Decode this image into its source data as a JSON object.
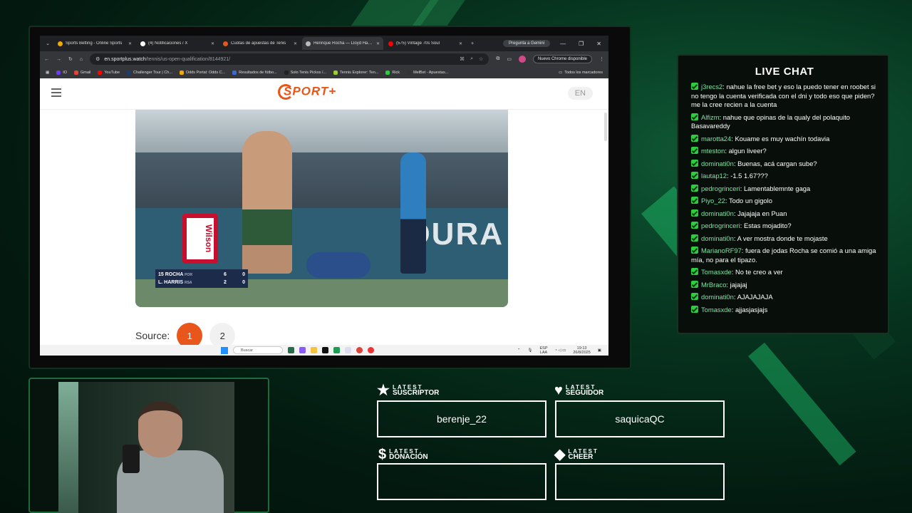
{
  "browser": {
    "tabs": [
      {
        "title": "Sports Betting - Online Sports",
        "color": "#f2a900",
        "active": false
      },
      {
        "title": "(4) Notificaciones / X",
        "color": "#ffffff",
        "active": false
      },
      {
        "title": "Cuotas de apuestas de Tenis",
        "color": "#e8561b",
        "active": false
      },
      {
        "title": "Henrique Rocha — Lloyd Harris",
        "color": "#bbbbbb",
        "active": true
      },
      {
        "title": "(575) Vintage 70s Soul",
        "color": "#ff0000",
        "active": false
      }
    ],
    "gemini_label": "Pregunta a Gemini",
    "url_host": "en.sportplus.watch",
    "url_path": "/tennis/us-open-qualification/8144921/",
    "chrome_update": "Nuevo Chrome disponible",
    "bookmarks": [
      {
        "label": "IO",
        "color": "#6a3df0"
      },
      {
        "label": "Gmail",
        "color": "#ea4335"
      },
      {
        "label": "YouTube",
        "color": "#ff0000"
      },
      {
        "label": "Challenger Tour | Ch...",
        "color": "#1f3b73"
      },
      {
        "label": "Odds Portal: Odds C...",
        "color": "#f2a900"
      },
      {
        "label": "Resultados de fútbo...",
        "color": "#3a6bd1"
      },
      {
        "label": "Solo Tenis Pickss /...",
        "color": "#222222"
      },
      {
        "label": "Tennis Explorer: Ten...",
        "color": "#9bcf2a"
      },
      {
        "label": "Rick",
        "color": "#2ecc40"
      },
      {
        "label": "MelBet - Apuestas...",
        "color": "#333333"
      }
    ],
    "bookmarks_all": "Todos los marcadores"
  },
  "site": {
    "logo_text": "SPORT+",
    "lang": "EN",
    "video": {
      "sponsor_wilson": "Wilson",
      "sponsor_oura": "ŌURA",
      "score": [
        {
          "player": "15 ROCHA",
          "country": "POR",
          "set": "6",
          "game": "0"
        },
        {
          "player": "L. HARRIS",
          "country": "RSA",
          "set": "2",
          "game": "0"
        }
      ]
    },
    "source_label": "Source:",
    "sources": [
      "1",
      "2"
    ]
  },
  "taskbar": {
    "search_placeholder": "Buscar",
    "lang_top": "ESP",
    "lang_bottom": "LAA",
    "time": "19:13",
    "date": "26/8/2025"
  },
  "chat": {
    "title": "LIVE CHAT",
    "messages": [
      {
        "user": "j3recs2",
        "text": "nahue la free bet y eso la puedo tener en roobet si no tengo la cuenta verificada con el dni y todo eso que piden? me la cree recien a la cuenta"
      },
      {
        "user": "Alfizm",
        "text": "nahue que opinas de la qualy del polaquito Basavareddy"
      },
      {
        "user": "marotta24",
        "text": "Kouame es muy wachín todavia"
      },
      {
        "user": "mteston",
        "text": "algun liveer?"
      },
      {
        "user": "dominati0n",
        "text": "Buenas, acá cargan sube?"
      },
      {
        "user": "lautap12",
        "text": "-1.5 1.67???"
      },
      {
        "user": "pedrogrinceri",
        "text": "Lamentablemnte gaga"
      },
      {
        "user": "Piyo_22",
        "text": "Todo un gigolo"
      },
      {
        "user": "dominati0n",
        "text": "Jajajaja en Puan"
      },
      {
        "user": "pedrogrinceri",
        "text": "Estas mojadito?"
      },
      {
        "user": "dominati0n",
        "text": "A ver mostra donde te mojaste"
      },
      {
        "user": "MarianoRF97",
        "text": "fuera de jodas Rocha se comió a una amiga mía, no para el tipazo."
      },
      {
        "user": "Tomasxde",
        "text": "No te creo a ver"
      },
      {
        "user": "MrBraco",
        "text": "jajajaj"
      },
      {
        "user": "dominati0n",
        "text": "AJAJAJAJA"
      },
      {
        "user": "Tomasxde",
        "text": "ajjasjasjajs"
      }
    ]
  },
  "alerts": {
    "subscriber": {
      "small": "LATEST",
      "big": "SUSCRIPTOR",
      "value": "berenje_22"
    },
    "follower": {
      "small": "LATEST",
      "big": "SEGUIDOR",
      "value": "saquicaQC"
    },
    "donation": {
      "small": "LATEST",
      "big": "DONACIÓN",
      "value": ""
    },
    "cheer": {
      "small": "LATEST",
      "big": "CHEER",
      "value": ""
    }
  }
}
